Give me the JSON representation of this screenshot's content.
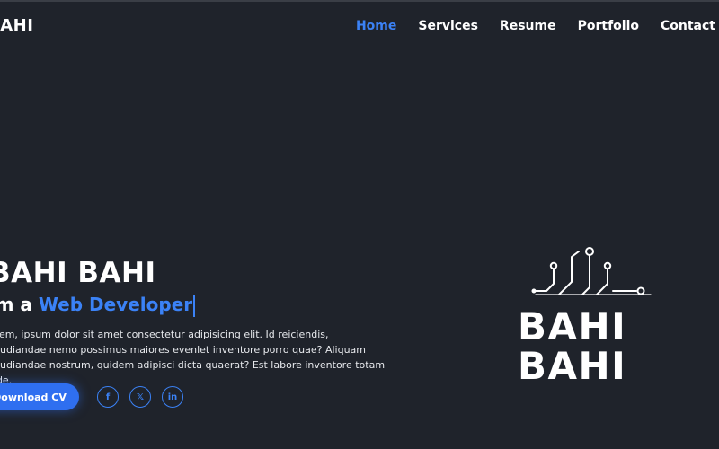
{
  "header": {
    "logo": "BAHI",
    "nav": [
      {
        "label": "Home",
        "active": true
      },
      {
        "label": "Services",
        "active": false
      },
      {
        "label": "Resume",
        "active": false
      },
      {
        "label": "Portfolio",
        "active": false
      },
      {
        "label": "Contact",
        "active": false
      }
    ]
  },
  "hero": {
    "name": "BAHI BAHI",
    "role_prefix": "I'm a ",
    "role_highlight": "Web Developer",
    "description": "Lorem, ipsum dolor sit amet consectetur adipisicing elit. Id reiciendis, repudiandae nemo possimus maiores evenlet inventore porro quae? Aliquam repudiandae nostrum, quidem adipisci dicta quaerat? Est labore inventore totam unde.",
    "download_label": "Download CV",
    "socials": [
      {
        "icon": "facebook-icon",
        "glyph": "f"
      },
      {
        "icon": "x-twitter-icon",
        "glyph": "𝕏"
      },
      {
        "icon": "linkedin-icon",
        "glyph": "in"
      }
    ]
  },
  "brand": {
    "line1": "BAHI",
    "line2": "BAHI"
  },
  "colors": {
    "background": "#1f232b",
    "accent": "#3b82f6",
    "button": "#2f6ff0",
    "text": "#ffffff"
  }
}
